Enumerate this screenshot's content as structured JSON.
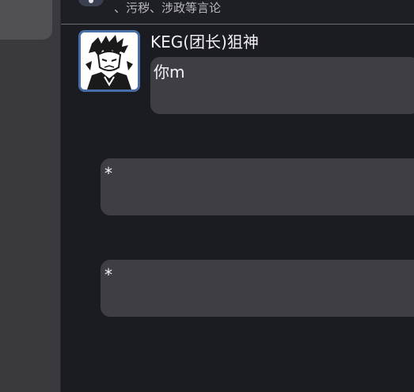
{
  "notice": {
    "text": "、污秽、涉政等言论",
    "icon": "info-icon"
  },
  "messages": [
    {
      "sender": "KEG(团长)狙神",
      "avatar": "anime-avatar-icon",
      "text": "你m"
    },
    {
      "text": "*"
    },
    {
      "text": "*"
    }
  ],
  "colors": {
    "background": "#1b1b22",
    "bubble": "#3e3e44",
    "avatar_border": "#4a6ea8",
    "left_panel": "#3a3a3e"
  }
}
